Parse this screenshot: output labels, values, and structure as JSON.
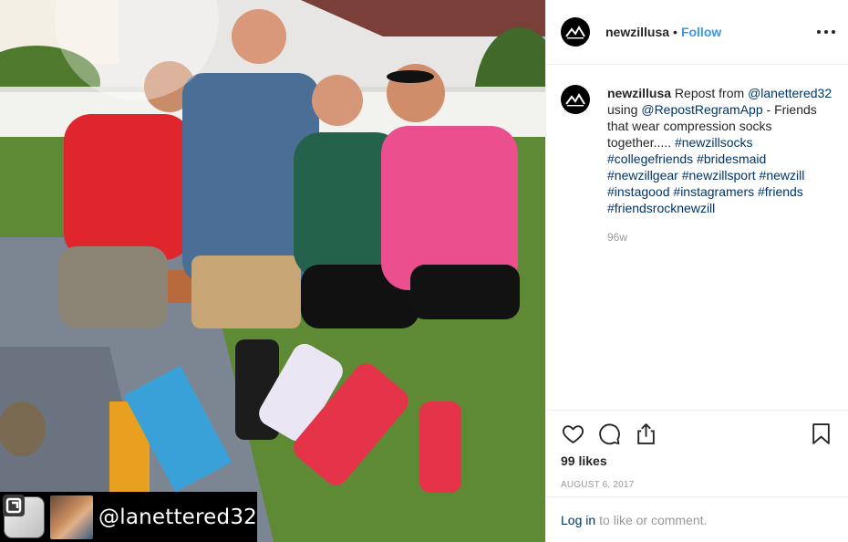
{
  "post": {
    "username": "newzillusa",
    "dot": "•",
    "follow_label": "Follow",
    "repost_handle": "@lanettered32"
  },
  "caption": {
    "username": "newzillusa",
    "text_1": "Repost from",
    "mention_1": "@lanettered32",
    "text_2": "using",
    "mention_2": "@RepostRegramApp",
    "text_3": "- Friends that wear compression socks together.....",
    "hashtags": [
      "#newzillsocks",
      "#collegefriends",
      "#bridesmaid",
      "#newzillgear",
      "#newzillsport",
      "#newzill",
      "#instagood",
      "#instagramers",
      "#friends",
      "#friendsrocknewzill"
    ],
    "time": "96w"
  },
  "engagement": {
    "likes": "99 likes",
    "date": "AUGUST 6, 2017"
  },
  "comment_bar": {
    "login_label": "Log in",
    "rest_label": "to like or comment."
  },
  "icons": {
    "like": "heart-icon",
    "comment": "comment-bubble-icon",
    "share": "share-icon",
    "save": "bookmark-icon",
    "more": "more-options-icon"
  },
  "colors": {
    "follow": "#3897f0",
    "link": "#003569",
    "muted": "#999999",
    "text": "#262626"
  }
}
